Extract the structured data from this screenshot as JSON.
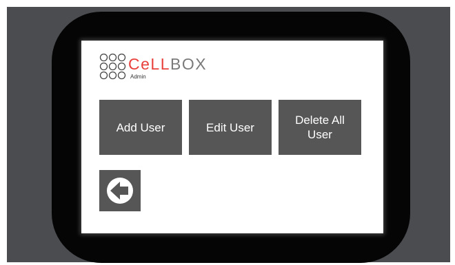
{
  "logo": {
    "wordmark_cell": "CeLL",
    "wordmark_box": "BOX",
    "subtitle": "Admin"
  },
  "buttons": {
    "add_user": "Add User",
    "edit_user": "Edit User",
    "delete_all_user": "Delete All User"
  },
  "icons": {
    "back": "back-arrow-icon"
  },
  "colors": {
    "backdrop": "#4a4c50",
    "bezel": "#050505",
    "screen": "#ffffff",
    "button": "#565656",
    "brand_red": "#e8403b",
    "brand_gray": "#7a7a7a"
  }
}
